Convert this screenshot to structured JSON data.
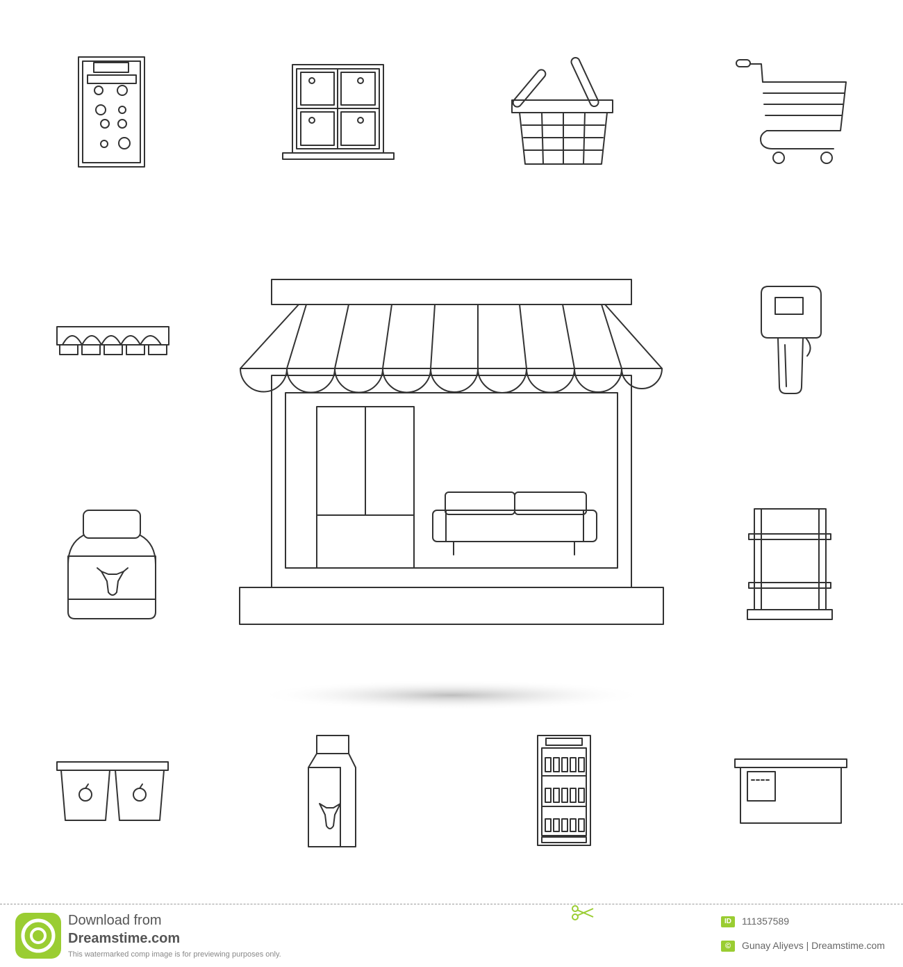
{
  "footer": {
    "download_from": "Download from",
    "site": "Dreamstime.com",
    "watermark_notice": "This watermarked comp image is for previewing purposes only.",
    "id_label": "ID",
    "image_id": "111357589",
    "copyright_symbol": "©",
    "credit": "Gunay Aliyevs | Dreamstime.com"
  },
  "colors": {
    "stroke": "#333333",
    "accent": "#9acd32",
    "background": "#ffffff"
  },
  "icons": [
    "calculator-icon",
    "lockers-icon",
    "shopping-basket-icon",
    "shopping-cart-icon",
    "egg-tray-icon",
    "barcode-scanner-icon",
    "store-icon",
    "milk-bottle-icon",
    "shelving-icon",
    "yogurt-cups-icon",
    "milk-carton-icon",
    "drinks-fridge-icon",
    "checkout-counter-icon"
  ]
}
